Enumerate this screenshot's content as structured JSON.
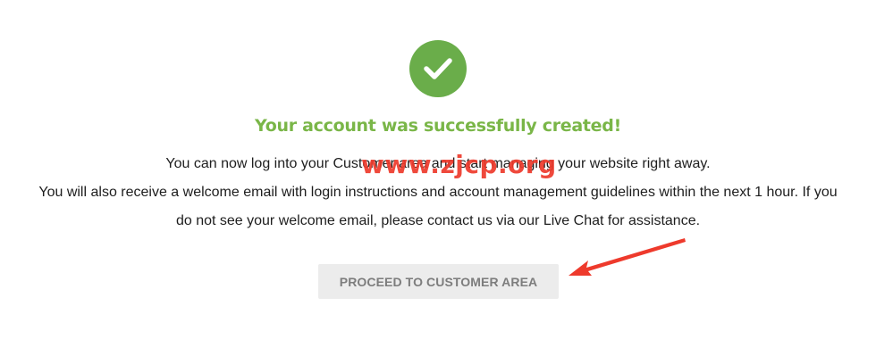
{
  "success": {
    "icon": "checkmark-icon",
    "color": "#6aad4a",
    "headline": "Your account was successfully created!"
  },
  "message": {
    "line1": "You can now log into your Customer area and start managing your website right away.",
    "line2": "You will also receive a welcome email with login instructions and account management guidelines within the next 1 hour. If you do not see your welcome email, please contact us via our Live Chat for assistance."
  },
  "actions": {
    "proceed_label": "PROCEED TO CUSTOMER AREA"
  },
  "overlay": {
    "watermark": "www.zjcp.org",
    "arrow_icon": "red-pointer-arrow-icon",
    "arrow_color": "#ee3a2c"
  }
}
